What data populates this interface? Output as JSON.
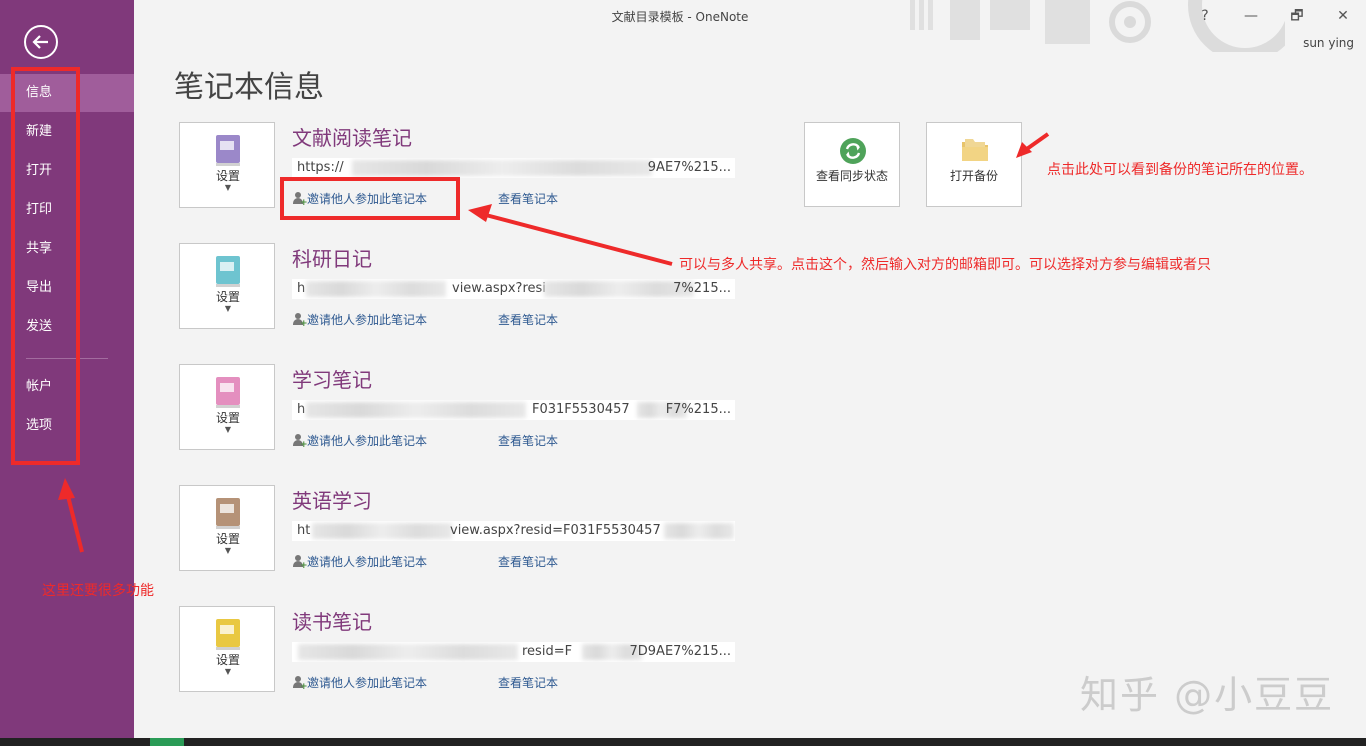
{
  "window": {
    "title": "文献目录模板 - OneNote",
    "help": "?",
    "minimize": "—",
    "restore": "🗗",
    "close": "✕",
    "user": "sun ying"
  },
  "sidebar": {
    "items": [
      {
        "label": "信息"
      },
      {
        "label": "新建"
      },
      {
        "label": "打开"
      },
      {
        "label": "打印"
      },
      {
        "label": "共享"
      },
      {
        "label": "导出"
      },
      {
        "label": "发送"
      },
      {
        "label": "帐户"
      },
      {
        "label": "选项"
      }
    ]
  },
  "main": {
    "page_title": "笔记本信息",
    "settings_label": "设置",
    "invite_label": "邀请他人参加此笔记本",
    "view_label": "查看笔记本",
    "notebooks": [
      {
        "name": "文献阅读笔记",
        "url_start": "https://",
        "url_end": "9AE7%215...",
        "color": "#9b88c9"
      },
      {
        "name": "科研日记",
        "url_start": "h",
        "url_end": "7%215...",
        "url_mid": "view.aspx?resi",
        "color": "#6ec4d0"
      },
      {
        "name": "学习笔记",
        "url_start": "h",
        "url_end": "F7%215...",
        "url_mid": "F031F5530457",
        "color": "#e48fbf"
      },
      {
        "name": "英语学习",
        "url_start": "ht",
        "url_mid": "view.aspx?resid=F031F5530457",
        "url_end": "",
        "color": "#b59277"
      },
      {
        "name": "读书笔记",
        "url_start": "",
        "url_end": "7D9AE7%215...",
        "url_mid": "resid=F",
        "color": "#e9c842"
      }
    ],
    "actions": {
      "sync_label": "查看同步状态",
      "backup_label": "打开备份"
    }
  },
  "annotations": {
    "backup_note": "点击此处可以看到备份的笔记所在的位置。",
    "share_note": "可以与多人共享。点击这个，然后输入对方的邮箱即可。可以选择对方参与编辑或者只",
    "sidebar_note": "这里还要很多功能"
  },
  "watermark": "知乎 @小豆豆",
  "colors": {
    "sidebar": "#80397b",
    "accent": "#80397b",
    "annotation": "#ee2a2a",
    "link": "#2f5a91"
  }
}
